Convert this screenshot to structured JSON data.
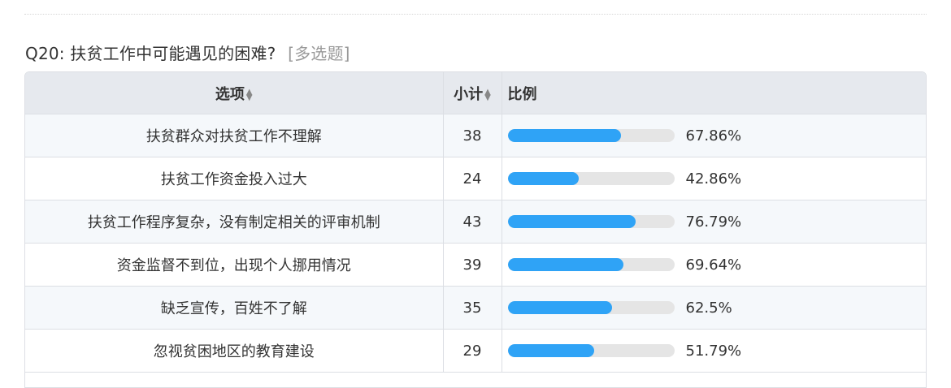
{
  "question": {
    "label": "Q20: 扶贫工作中可能遇见的困难?",
    "tag": "[多选题]"
  },
  "table": {
    "headers": {
      "option": "选项",
      "count": "小计",
      "ratio": "比例"
    },
    "sort_icon": "sort-icon",
    "rows": [
      {
        "option": "扶贫群众对扶贫工作不理解",
        "count": "38",
        "percent": "67.86%",
        "fraction": 0.6786
      },
      {
        "option": "扶贫工作资金投入过大",
        "count": "24",
        "percent": "42.86%",
        "fraction": 0.4286
      },
      {
        "option": "扶贫工作程序复杂，没有制定相关的评审机制",
        "count": "43",
        "percent": "76.79%",
        "fraction": 0.7679
      },
      {
        "option": "资金监督不到位，出现个人挪用情况",
        "count": "39",
        "percent": "69.64%",
        "fraction": 0.6964
      },
      {
        "option": "缺乏宣传，百姓不了解",
        "count": "35",
        "percent": "62.5%",
        "fraction": 0.625
      },
      {
        "option": "忽视贫困地区的教育建设",
        "count": "29",
        "percent": "51.79%",
        "fraction": 0.5179
      }
    ]
  },
  "colors": {
    "bar_fill": "#2fa3f6",
    "bar_track": "#e5e5e5",
    "header_bg": "#e6e9ee",
    "row_alt_bg": "#f5f8fb"
  }
}
